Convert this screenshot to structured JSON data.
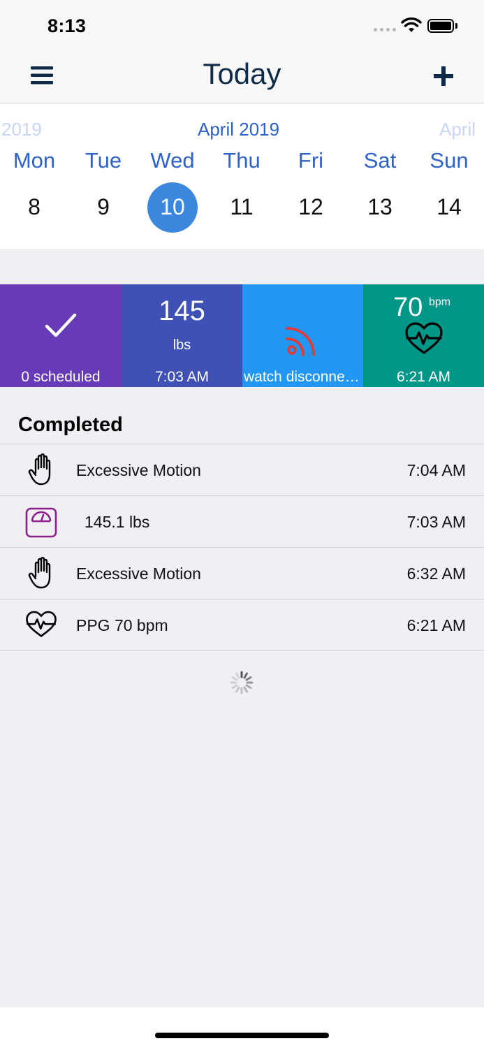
{
  "status_bar": {
    "time": "8:13"
  },
  "nav": {
    "title": "Today"
  },
  "calendar": {
    "month_prev": "2019",
    "month_current": "April 2019",
    "month_next": "April",
    "weekdays": [
      "Mon",
      "Tue",
      "Wed",
      "Thu",
      "Fri",
      "Sat",
      "Sun"
    ],
    "days": [
      "8",
      "9",
      "10",
      "11",
      "12",
      "13",
      "14"
    ],
    "selected_day": "10",
    "selected_color": "#3b87dd",
    "accent_color": "#2f62c7"
  },
  "tiles": [
    {
      "icon": "checkmark-icon",
      "label": "0 scheduled",
      "color": "#673ab7"
    },
    {
      "value": "145",
      "unit": "lbs",
      "label": "7:03 AM",
      "color": "#3f51b5"
    },
    {
      "icon": "rss-disconnected-icon",
      "label": "watch disconnected",
      "color": "#2196f3",
      "icon_color": "#e53935"
    },
    {
      "value": "70",
      "unit": "bpm",
      "icon": "heart-pulse-icon",
      "label": "6:21 AM",
      "color": "#009688"
    }
  ],
  "completed": {
    "title": "Completed",
    "items": [
      {
        "icon": "hand-icon",
        "text": "Excessive Motion",
        "time": "7:04 AM"
      },
      {
        "icon": "scale-icon",
        "text": "145.1 lbs",
        "time": "7:03 AM"
      },
      {
        "icon": "hand-icon",
        "text": "Excessive Motion",
        "time": "6:32 AM"
      },
      {
        "icon": "heart-pulse-icon",
        "text": "PPG 70 bpm",
        "time": "6:21 AM"
      }
    ]
  }
}
